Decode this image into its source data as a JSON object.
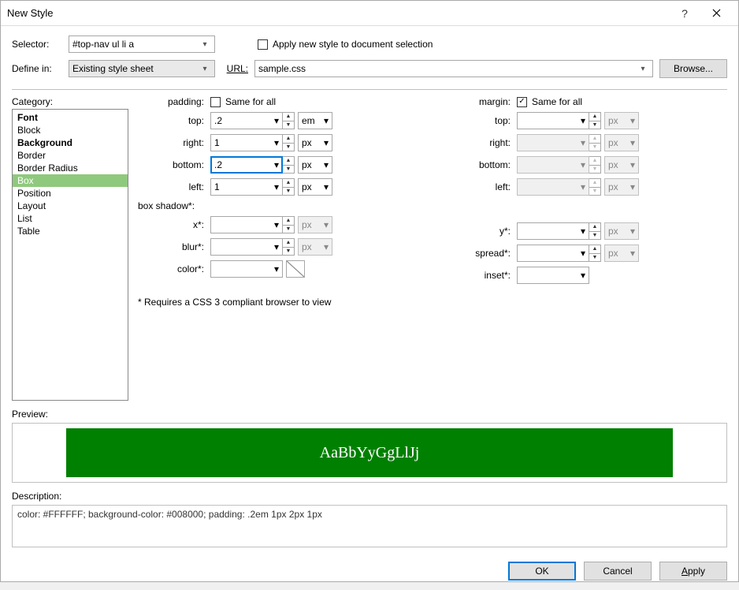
{
  "window": {
    "title": "New Style"
  },
  "top": {
    "selector_label": "Selector:",
    "selector_value": "#top-nav ul li a",
    "apply_label": "Apply new style to document selection",
    "apply_checked": false,
    "definein_label": "Define in:",
    "definein_value": "Existing style sheet",
    "url_label": "URL:",
    "url_value": "sample.css",
    "browse_label": "Browse..."
  },
  "category": {
    "label": "Category:",
    "items": [
      {
        "label": "Font",
        "bold": true
      },
      {
        "label": "Block",
        "bold": false
      },
      {
        "label": "Background",
        "bold": true
      },
      {
        "label": "Border",
        "bold": false
      },
      {
        "label": "Border Radius",
        "bold": false
      },
      {
        "label": "Box",
        "bold": false,
        "selected": true
      },
      {
        "label": "Position",
        "bold": false
      },
      {
        "label": "Layout",
        "bold": false
      },
      {
        "label": "List",
        "bold": false
      },
      {
        "label": "Table",
        "bold": false
      }
    ]
  },
  "box": {
    "padding_label": "padding:",
    "padding_same_label": "Same for all",
    "padding_same_checked": false,
    "margin_label": "margin:",
    "margin_same_label": "Same for all",
    "margin_same_checked": true,
    "padding": {
      "top": {
        "label": "top:",
        "value": ".2",
        "unit": "em"
      },
      "right": {
        "label": "right:",
        "value": "1",
        "unit": "px"
      },
      "bottom": {
        "label": "bottom:",
        "value": ".2",
        "unit": "px",
        "focused": true
      },
      "left": {
        "label": "left:",
        "value": "1",
        "unit": "px"
      }
    },
    "margin": {
      "top": {
        "label": "top:",
        "value": "",
        "unit": "px"
      },
      "right": {
        "label": "right:",
        "value": "",
        "unit": "px"
      },
      "bottom": {
        "label": "bottom:",
        "value": "",
        "unit": "px"
      },
      "left": {
        "label": "left:",
        "value": "",
        "unit": "px"
      }
    },
    "boxshadow_label": "box shadow*:",
    "shadow": {
      "x": {
        "label": "x*:",
        "value": "",
        "unit": "px"
      },
      "y": {
        "label": "y*:",
        "value": "",
        "unit": "px"
      },
      "blur": {
        "label": "blur*:",
        "value": "",
        "unit": "px"
      },
      "spread": {
        "label": "spread*:",
        "value": "",
        "unit": "px"
      },
      "color": {
        "label": "color*:",
        "value": ""
      },
      "inset": {
        "label": "inset*:",
        "value": ""
      }
    },
    "footnote": "* Requires a CSS 3 compliant browser to view"
  },
  "preview": {
    "label": "Preview:",
    "sample_text": "AaBbYyGgLlJj",
    "bg": "#008000",
    "fg": "#FFFFFF"
  },
  "description": {
    "label": "Description:",
    "text": "color: #FFFFFF; background-color: #008000; padding: .2em 1px 2px 1px"
  },
  "buttons": {
    "ok": "OK",
    "cancel": "Cancel",
    "apply": "Apply"
  }
}
